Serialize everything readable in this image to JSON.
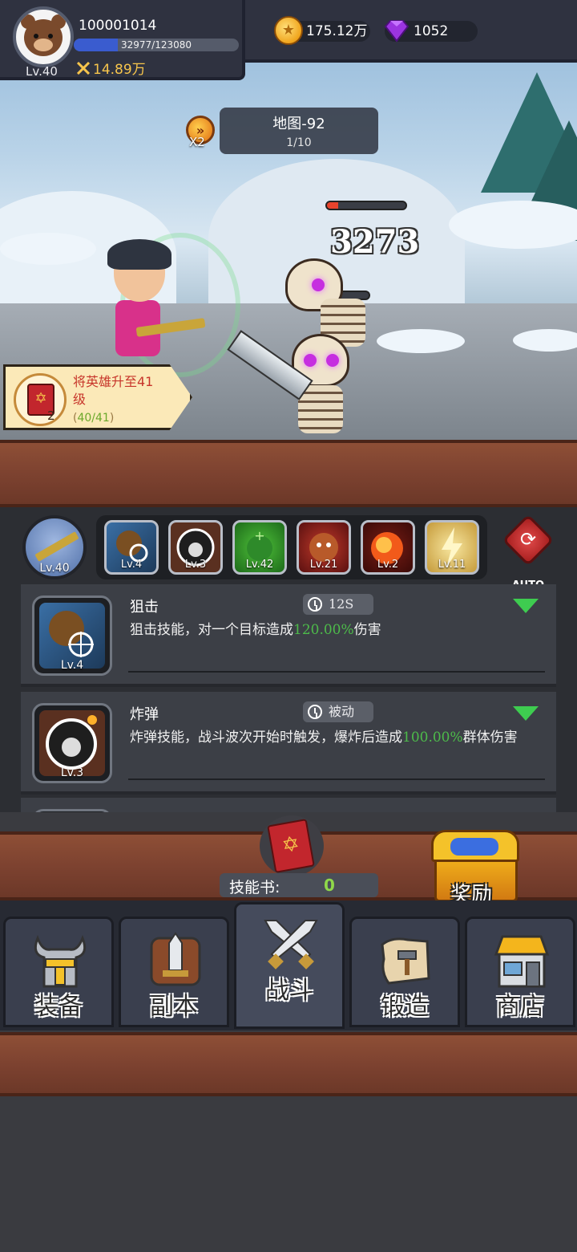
{
  "player": {
    "id": "100001014",
    "level_label": "Lv.40",
    "exp_text": "32977/123080",
    "exp_progress": 0.268,
    "power": "14.89万"
  },
  "currency": {
    "gold": "175.12万",
    "gems": "1052"
  },
  "stage": {
    "speed_label": "X2",
    "map_name": "地图-92",
    "wave": "1/10"
  },
  "battle": {
    "damage_number": "3273"
  },
  "quest": {
    "text": "将英雄升至41级",
    "book_count": "2",
    "progress_open": "(",
    "progress_current": "40/41",
    "progress_close": ")"
  },
  "skill_bar": {
    "weapon_level": "Lv.40",
    "slots": [
      {
        "level": "Lv.4"
      },
      {
        "level": "Lv.3"
      },
      {
        "level": "Lv.42"
      },
      {
        "level": "Lv.21"
      },
      {
        "level": "Lv.2"
      },
      {
        "level": "Lv.11"
      }
    ],
    "auto_label": "AUTO"
  },
  "skills": [
    {
      "name": "狙击",
      "cooldown": "12S",
      "level": "Lv.4",
      "desc_before": "狙击技能，对一个目标造成",
      "desc_value": "120.00%",
      "desc_after": "伤害"
    },
    {
      "name": "炸弹",
      "cooldown": "被动",
      "level": "Lv.3",
      "desc_before": "炸弹技能，战斗波次开始时触发，爆炸后造成",
      "desc_value": "100.00%",
      "desc_after": "群体伤害"
    }
  ],
  "skill_book": {
    "label": "技能书:",
    "value": "0"
  },
  "reward": {
    "label": "奖励"
  },
  "nav": {
    "tabs": [
      {
        "label": "装备"
      },
      {
        "label": "副本"
      },
      {
        "label": "战斗"
      },
      {
        "label": "锻造"
      },
      {
        "label": "商店"
      }
    ]
  },
  "colors": {
    "highlight_green": "#4dbb4a",
    "wood": "#7d4230",
    "panel": "#2c2e33"
  }
}
